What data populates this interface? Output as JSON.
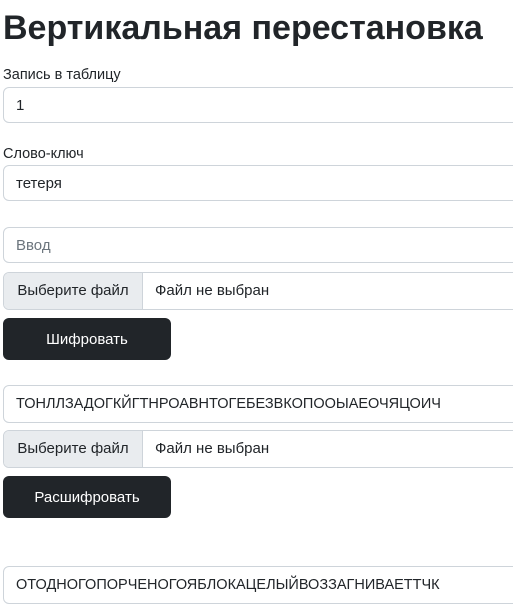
{
  "title": "Вертикальная перестановка",
  "table_entry": {
    "label": "Запись в таблицу",
    "value": "1"
  },
  "keyword": {
    "label": "Слово-ключ",
    "value": "тетеря"
  },
  "input": {
    "placeholder": "Ввод"
  },
  "file_input_1": {
    "button": "Выберите файл",
    "status": "Файл не выбран"
  },
  "encrypt_button": "Шифровать",
  "encrypted_text": "ТОНЛЛЗАДОГКЙГТНРОАВНТОГЕБЕЗВКОПООЫАЕОЧЯЦОИЧ",
  "file_input_2": {
    "button": "Выберите файл",
    "status": "Файл не выбран"
  },
  "decrypt_button": "Расшифровать",
  "decrypted_text": "ОТОДНОГОПОРЧЕНОГОЯБЛОКАЦЕЛЫЙВОЗЗАГНИВАЕТТЧК"
}
